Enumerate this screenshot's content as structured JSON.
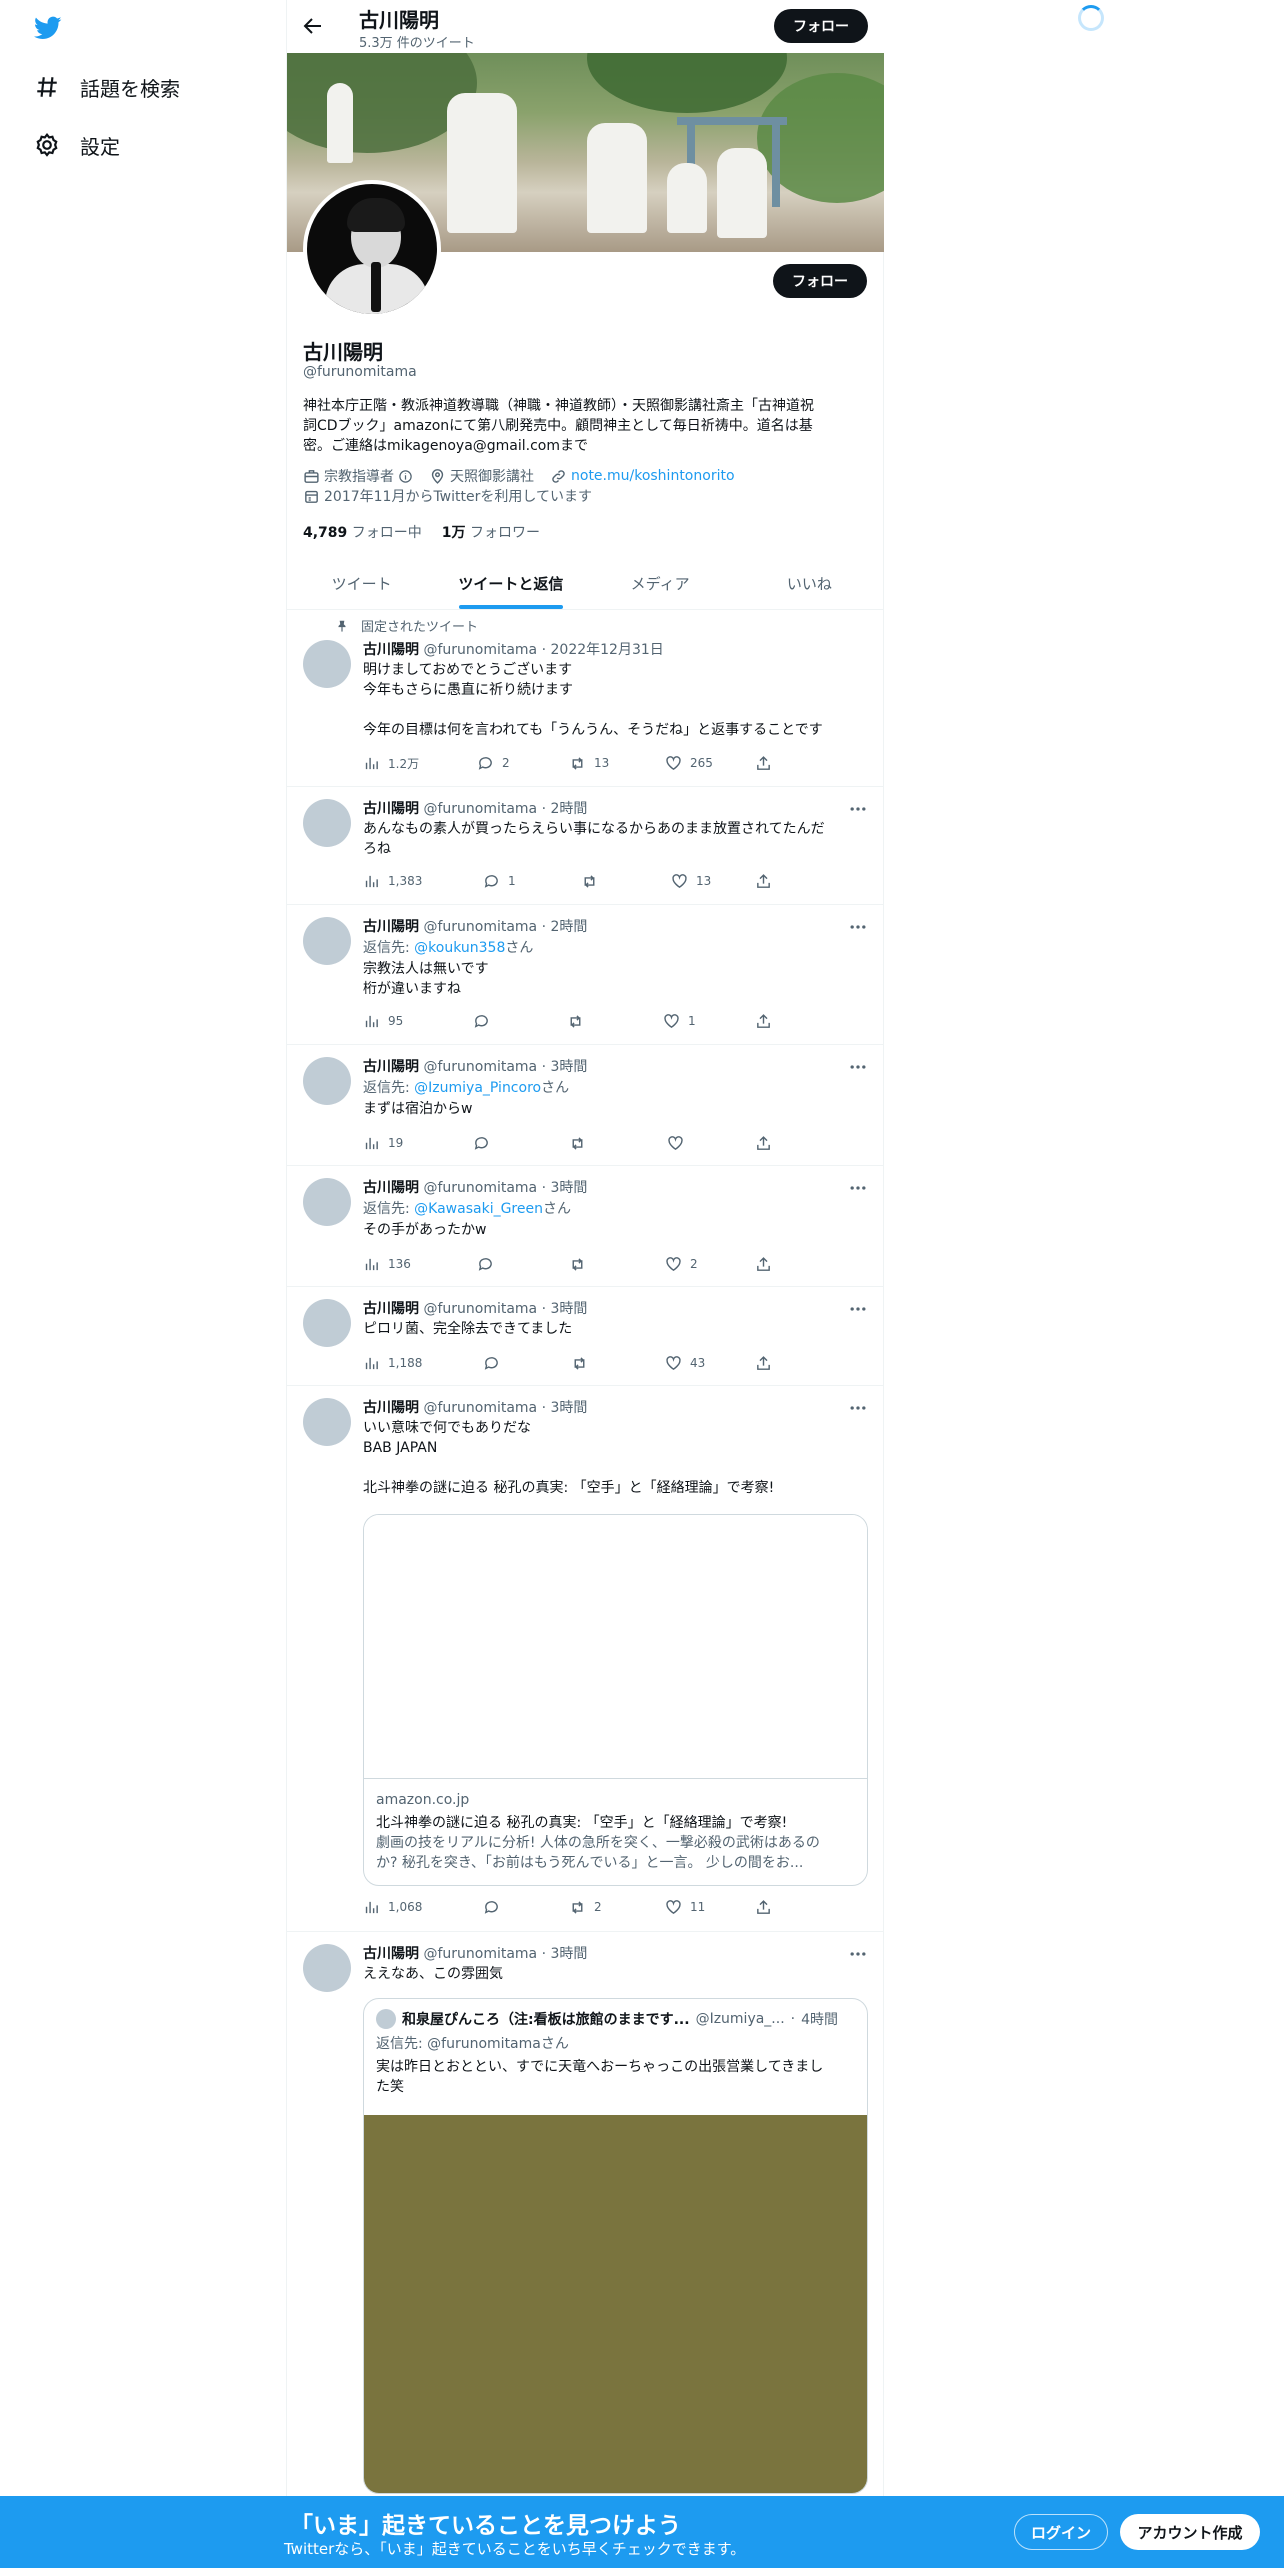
{
  "nav": {
    "logo": "twitter-bird-icon",
    "items": [
      {
        "label": "話題を検索",
        "icon": "hashtag-icon"
      },
      {
        "label": "設定",
        "icon": "gear-icon"
      }
    ]
  },
  "header": {
    "name": "古川陽明",
    "tweet_count": "5.3万 件のツイート",
    "follow_label": "フォロー"
  },
  "profile": {
    "name": "古川陽明",
    "handle": "@furunomitama",
    "follow_label": "フォロー",
    "bio": "神社本庁正階・教派神道教導職（神職・神道教師）・天照御影講社斎主「古神道祝\n詞CDブック」amazonにて第八刷発売中。顧問神主として毎日祈祷中。道名は基\n密。ご連絡はmikagenoya@gmail.comまで",
    "category": "宗教指導者",
    "location": "天照御影講社",
    "url": "note.mu/koshintonorito",
    "joined": "2017年11月からTwitterを利用しています",
    "following_count": "4,789",
    "following_label": "フォロー中",
    "followers_count": "1万",
    "followers_label": "フォロワー"
  },
  "tabs": [
    "ツイート",
    "ツイートと返信",
    "メディア",
    "いいね"
  ],
  "active_tab": 1,
  "pinned_label": "固定されたツイート",
  "tweets": [
    {
      "name": "古川陽明",
      "handle": "@furunomitama",
      "time": "2022年12月31日",
      "text": "明けましておめでとうございます\n今年もさらに愚直に祈り続けます\n\n今年の目標は何を言われても「うんうん、そうだね」と返事することです",
      "views": "1.2万",
      "replies": "2",
      "retweets": "13",
      "likes": "265"
    },
    {
      "name": "古川陽明",
      "handle": "@furunomitama",
      "time": "2時間",
      "text": "あんなもの素人が買ったらえらい事になるからあのまま放置されてたんだ\nろね",
      "views": "1,383",
      "replies": "1",
      "retweets": "",
      "likes": "13"
    },
    {
      "name": "古川陽明",
      "handle": "@furunomitama",
      "time": "2時間",
      "reply_prefix": "返信先: ",
      "reply_to": "@koukun358",
      "reply_suffix": "さん",
      "text": "宗教法人は無いです\n桁が違いますね",
      "views": "95",
      "replies": "",
      "retweets": "",
      "likes": "1"
    },
    {
      "name": "古川陽明",
      "handle": "@furunomitama",
      "time": "3時間",
      "reply_prefix": "返信先: ",
      "reply_to": "@Izumiya_Pincoro",
      "reply_suffix": "さん",
      "text": "まずは宿泊からw",
      "views": "19",
      "replies": "",
      "retweets": "",
      "likes": ""
    },
    {
      "name": "古川陽明",
      "handle": "@furunomitama",
      "time": "3時間",
      "reply_prefix": "返信先: ",
      "reply_to": "@Kawasaki_Green",
      "reply_suffix": "さん",
      "text": "その手があったかw",
      "views": "136",
      "replies": "",
      "retweets": "",
      "likes": "2"
    },
    {
      "name": "古川陽明",
      "handle": "@furunomitama",
      "time": "3時間",
      "text": "ピロリ菌、完全除去できてました",
      "views": "1,188",
      "replies": "",
      "retweets": "",
      "likes": "43"
    },
    {
      "name": "古川陽明",
      "handle": "@furunomitama",
      "time": "3時間",
      "text": "いい意味で何でもありだな\nBAB JAPAN\n\n北斗神拳の謎に迫る 秘孔の真実: 「空手」と「経絡理論」で考察!",
      "card": {
        "domain": "amazon.co.jp",
        "title": "北斗神拳の謎に迫る 秘孔の真実: 「空手」と「経絡理論」で考察!",
        "description": "劇画の技をリアルに分析! 人体の急所を突く、一撃必殺の武術はあるの\nか? 秘孔を突き、「お前はもう死んでいる」と一言。 少しの間をお..."
      },
      "views": "1,068",
      "replies": "",
      "retweets": "2",
      "likes": "11"
    },
    {
      "name": "古川陽明",
      "handle": "@furunomitama",
      "time": "3時間",
      "text": "ええなあ、この雰囲気",
      "quote": {
        "name": "和泉屋ぴんころ（注:看板は旅館のままです...",
        "handle": "@Izumiya_...",
        "time": "4時間",
        "reply": "返信先: @furunomitamaさん",
        "text": "実は昨日とおととい、すでに天竜へおーちゃっこの出張営業してきまし\nた笑"
      }
    }
  ],
  "bottom": {
    "title": "「いま」起きていることを見つけよう",
    "subtitle": "Twitterなら、「いま」起きていることをいち早くチェックできます。",
    "login": "ログイン",
    "signup": "アカウント作成"
  },
  "colors": {
    "accent": "#1d9bf0",
    "text": "#0f1419",
    "muted": "#536471"
  }
}
